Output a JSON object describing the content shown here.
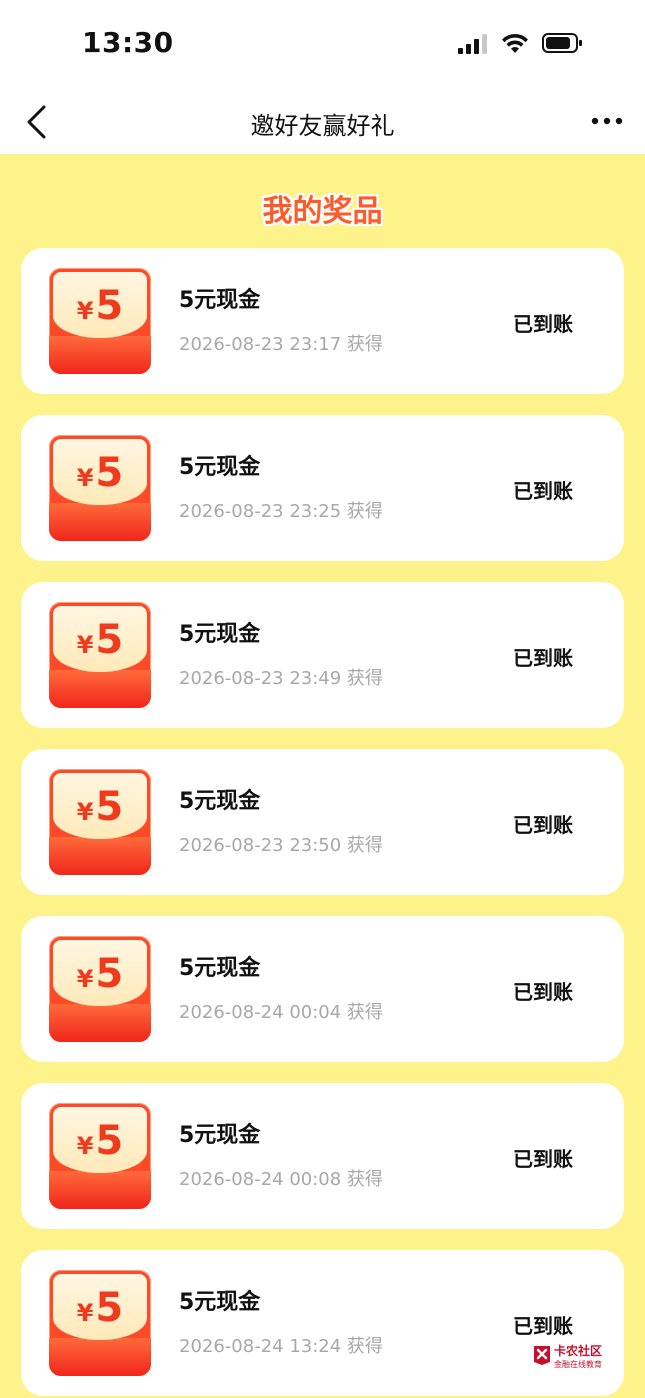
{
  "status_bar": {
    "time": "13:30"
  },
  "nav": {
    "title": "邀好友赢好礼"
  },
  "section": {
    "title": "我的奖品"
  },
  "rewards": [
    {
      "currency": "¥",
      "amount": "5",
      "name": "5元现金",
      "time": "2026-08-23 23:17 获得",
      "status": "已到账"
    },
    {
      "currency": "¥",
      "amount": "5",
      "name": "5元现金",
      "time": "2026-08-23 23:25 获得",
      "status": "已到账"
    },
    {
      "currency": "¥",
      "amount": "5",
      "name": "5元现金",
      "time": "2026-08-23 23:49 获得",
      "status": "已到账"
    },
    {
      "currency": "¥",
      "amount": "5",
      "name": "5元现金",
      "time": "2026-08-23 23:50 获得",
      "status": "已到账"
    },
    {
      "currency": "¥",
      "amount": "5",
      "name": "5元现金",
      "time": "2026-08-24 00:04 获得",
      "status": "已到账"
    },
    {
      "currency": "¥",
      "amount": "5",
      "name": "5元现金",
      "time": "2026-08-24 00:08 获得",
      "status": "已到账"
    },
    {
      "currency": "¥",
      "amount": "5",
      "name": "5元现金",
      "time": "2026-08-24 13:24 获得",
      "status": "已到账"
    }
  ],
  "watermark": {
    "title": "卡农社区",
    "subtitle": "金融在线教育"
  },
  "colors": {
    "page_bg": "#fef28a",
    "accent": "#ff5b2a",
    "coupon_red": "#f0261c"
  }
}
